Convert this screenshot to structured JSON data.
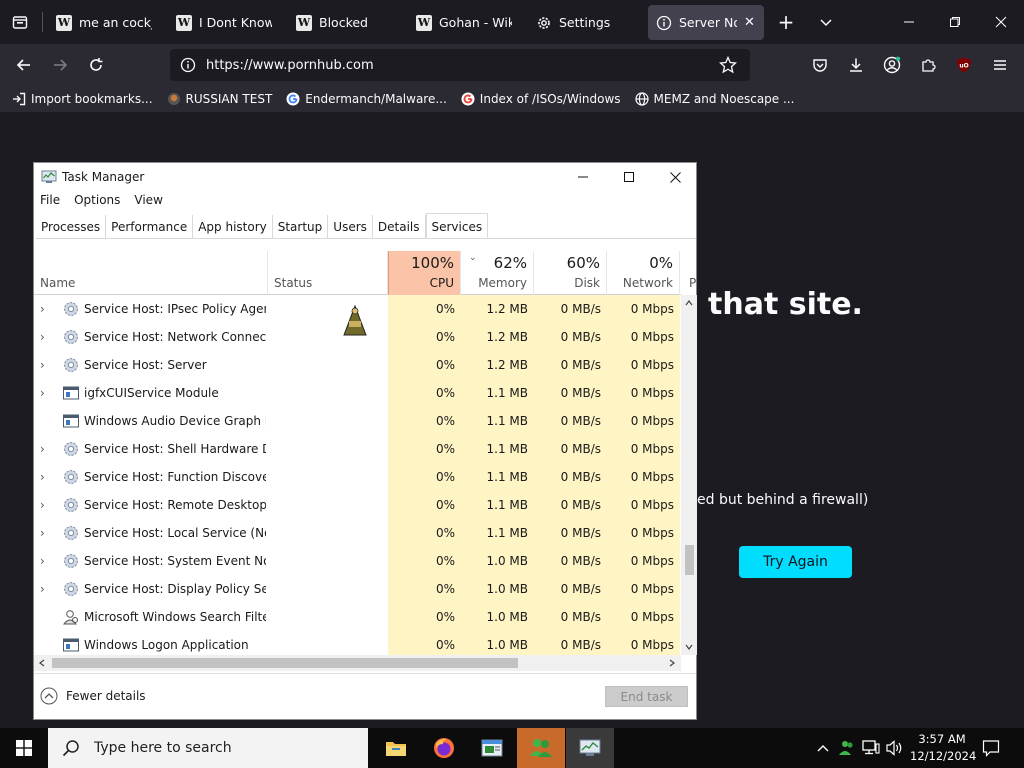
{
  "browser": {
    "tabs": [
      {
        "label": "me an cockjo",
        "icon": "wikipedia-icon"
      },
      {
        "label": "I Dont Know H",
        "icon": "wikipedia-icon"
      },
      {
        "label": "Blocked",
        "icon": "wikipedia-icon"
      },
      {
        "label": "Gohan - Wikip",
        "icon": "wikipedia-icon"
      },
      {
        "label": "Settings",
        "icon": "gear-icon"
      },
      {
        "label": "Server Not F",
        "icon": "info-icon",
        "active": true
      }
    ],
    "url": "https://www.pornhub.com",
    "bookmarks": [
      {
        "label": "Import bookmarks...",
        "icon": "import-icon"
      },
      {
        "label": "RUSSIAN TEST",
        "icon": "site-icon"
      },
      {
        "label": "Endermanch/Malware...",
        "icon": "google-icon"
      },
      {
        "label": "Index of /ISOs/Windows",
        "icon": "google-icon"
      },
      {
        "label": "MEMZ and Noescape ...",
        "icon": "globe-icon"
      }
    ]
  },
  "error_page": {
    "title_fragment": "that site.",
    "body_fragment": "ed but behind a firewall)",
    "try_again_label": "Try Again"
  },
  "task_manager": {
    "title": "Task Manager",
    "menu": [
      "File",
      "Options",
      "View"
    ],
    "tabs": [
      "Processes",
      "Performance",
      "App history",
      "Startup",
      "Users",
      "Details",
      "Services"
    ],
    "active_tab": "Services",
    "columns": {
      "name": "Name",
      "status": "Status",
      "cpu_pct": "100%",
      "cpu": "CPU",
      "mem_pct": "62%",
      "mem": "Memory",
      "disk_pct": "60%",
      "disk": "Disk",
      "net_pct": "0%",
      "net": "Network",
      "extra": "P"
    },
    "rows": [
      {
        "name": "Service Host: IPsec Policy Agent",
        "expand": true,
        "icon": "gear",
        "cpu": "0%",
        "mem": "1.2 MB",
        "disk": "0 MB/s",
        "net": "0 Mbps"
      },
      {
        "name": "Service Host: Network Connecti...",
        "expand": true,
        "icon": "gear",
        "cpu": "0%",
        "mem": "1.2 MB",
        "disk": "0 MB/s",
        "net": "0 Mbps"
      },
      {
        "name": "Service Host: Server",
        "expand": true,
        "icon": "gear",
        "cpu": "0%",
        "mem": "1.2 MB",
        "disk": "0 MB/s",
        "net": "0 Mbps"
      },
      {
        "name": "igfxCUIService Module",
        "expand": true,
        "icon": "window",
        "cpu": "0%",
        "mem": "1.1 MB",
        "disk": "0 MB/s",
        "net": "0 Mbps"
      },
      {
        "name": "Windows Audio Device Graph Is...",
        "expand": false,
        "icon": "window",
        "cpu": "0%",
        "mem": "1.1 MB",
        "disk": "0 MB/s",
        "net": "0 Mbps"
      },
      {
        "name": "Service Host: Shell Hardware De...",
        "expand": true,
        "icon": "gear",
        "cpu": "0%",
        "mem": "1.1 MB",
        "disk": "0 MB/s",
        "net": "0 Mbps"
      },
      {
        "name": "Service Host: Function Discover...",
        "expand": true,
        "icon": "gear",
        "cpu": "0%",
        "mem": "1.1 MB",
        "disk": "0 MB/s",
        "net": "0 Mbps"
      },
      {
        "name": "Service Host: Remote Desktop C...",
        "expand": true,
        "icon": "gear",
        "cpu": "0%",
        "mem": "1.1 MB",
        "disk": "0 MB/s",
        "net": "0 Mbps"
      },
      {
        "name": "Service Host: Local Service (No ...",
        "expand": true,
        "icon": "gear",
        "cpu": "0%",
        "mem": "1.1 MB",
        "disk": "0 MB/s",
        "net": "0 Mbps"
      },
      {
        "name": "Service Host: System Event Noti...",
        "expand": true,
        "icon": "gear",
        "cpu": "0%",
        "mem": "1.0 MB",
        "disk": "0 MB/s",
        "net": "0 Mbps"
      },
      {
        "name": "Service Host: Display Policy Serv...",
        "expand": true,
        "icon": "gear",
        "cpu": "0%",
        "mem": "1.0 MB",
        "disk": "0 MB/s",
        "net": "0 Mbps"
      },
      {
        "name": "Microsoft Windows Search Filte...",
        "expand": false,
        "icon": "search-person",
        "cpu": "0%",
        "mem": "1.0 MB",
        "disk": "0 MB/s",
        "net": "0 Mbps"
      },
      {
        "name": "Windows Logon Application",
        "expand": false,
        "icon": "window",
        "cpu": "0%",
        "mem": "1.0 MB",
        "disk": "0 MB/s",
        "net": "0 Mbps"
      }
    ],
    "fewer_details": "Fewer details",
    "end_task": "End task"
  },
  "taskbar": {
    "search_placeholder": "Type here to search",
    "time": "3:57 AM",
    "date": "12/12/2024",
    "apps": [
      "file-explorer-icon",
      "firefox-icon",
      "notepad-icon",
      "green-users-icon",
      "task-manager-icon"
    ]
  },
  "colors": {
    "browser_bg": "#1c1b22",
    "toolbar_bg": "#2b2a33",
    "accent_button": "#00ddff",
    "cpu_header_highlight": "#fbc4a9",
    "column_highlight": "#fff4c4"
  }
}
